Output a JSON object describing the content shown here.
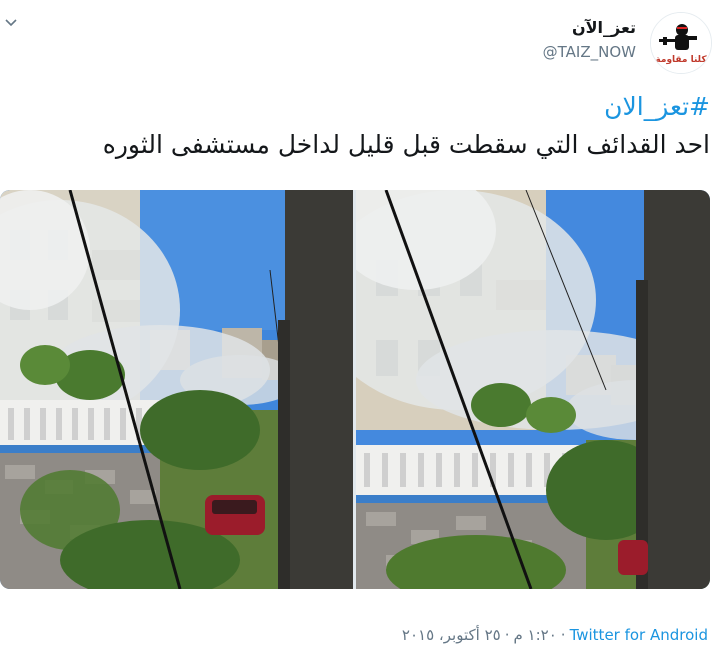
{
  "tweet": {
    "user": {
      "display_name": "تعز_الآن",
      "handle": "@TAIZ_NOW",
      "avatar_logo_text": "كلنا مقاومة"
    },
    "hashtag": "#تعز_الان",
    "text": "احد القدائف التي سقطت قبل قليل لداخل مستشفى الثوره",
    "footer": {
      "time": "١:٢٠ م",
      "date": "٢٥ أكتوبر، ٢٠١٥",
      "source": "Twitter for Android",
      "separator": "·"
    },
    "media": {
      "photos": [
        {
          "description_icon": "photo-smoke-hospital-left"
        },
        {
          "description_icon": "photo-smoke-hospital-right"
        }
      ]
    }
  },
  "colors": {
    "link": "#1b95e0",
    "secondary_text": "#657786",
    "primary_text": "#14171a",
    "sky": "#3a7fd6",
    "smoke": "#dfe3e4",
    "foliage": "#3f6b2a",
    "railing": "#f2f2f2",
    "railing_base": "#3b7ec9",
    "pole": "#3b3a36"
  }
}
